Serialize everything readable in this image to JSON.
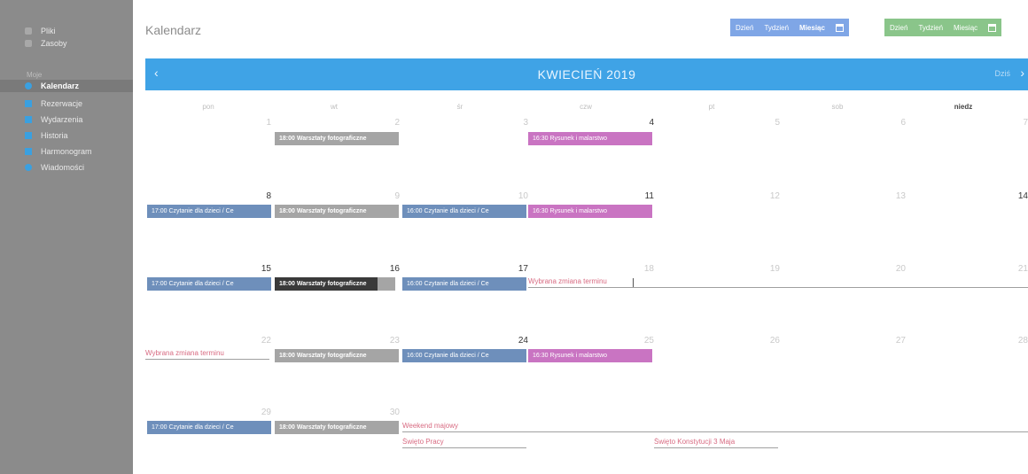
{
  "sidebar": {
    "top_items": [
      {
        "label": "Pliki",
        "icon": "file-icon"
      },
      {
        "label": "Zasoby",
        "icon": "resources-icon"
      }
    ],
    "section_label": "Moje",
    "items": [
      {
        "label": "Kalendarz",
        "icon": "calendar-icon"
      },
      {
        "label": "Rezerwacje",
        "icon": "bookmark-icon"
      },
      {
        "label": "Wydarzenia",
        "icon": "event-icon"
      },
      {
        "label": "Historia",
        "icon": "history-icon"
      },
      {
        "label": "Harmonogram",
        "icon": "schedule-icon"
      },
      {
        "label": "Wiadomości",
        "icon": "message-icon"
      }
    ]
  },
  "header": {
    "title": "Kalendarz",
    "view_buttons": [
      "Dzień",
      "Tydzień",
      "Miesiąc"
    ],
    "view_buttons_2": [
      "Dzień",
      "Tydzień",
      "Miesiąc"
    ]
  },
  "calendar": {
    "month_title": "KWIECIEŃ 2019",
    "prev_label": "‹",
    "next_label": "›",
    "today_label": "Dziś",
    "weekdays": [
      "pon",
      "wt",
      "śr",
      "czw",
      "pt",
      "sob",
      "niedz"
    ],
    "weeks": [
      {
        "days": [
          "1",
          "2",
          "3",
          "4",
          "5",
          "6",
          "7"
        ]
      },
      {
        "days": [
          "8",
          "9",
          "10",
          "11",
          "12",
          "13",
          "14"
        ]
      },
      {
        "days": [
          "15",
          "16",
          "17",
          "18",
          "19",
          "20",
          "21"
        ]
      },
      {
        "days": [
          "22",
          "23",
          "24",
          "25",
          "26",
          "27",
          "28"
        ]
      },
      {
        "days": [
          "29",
          "30",
          "",
          "",
          "",
          "",
          ""
        ]
      }
    ],
    "events": [
      {
        "text": "18:00 Warsztaty fotograficzne",
        "kind": "grey"
      },
      {
        "text": "16:30 Rysunek i malarstwo",
        "kind": "pink"
      },
      {
        "text": "17:00 Czytanie dla dzieci / Ce",
        "kind": "blue"
      },
      {
        "text": "18:00 Warsztaty fotograficzne",
        "kind": "grey"
      },
      {
        "text": "16:00 Czytanie dla dzieci / Ce",
        "kind": "blue"
      },
      {
        "text": "16:30 Rysunek i malarstwo",
        "kind": "pink"
      },
      {
        "text": "17:00 Czytanie dla dzieci / Ce",
        "kind": "blue"
      },
      {
        "text": "18:00 Warsztaty fotograficzne",
        "kind": "dark"
      },
      {
        "text": "16:00 Czytanie dla dzieci / Ce",
        "kind": "blue"
      },
      {
        "text": "Wybrana zmiana terminu",
        "kind": "text"
      },
      {
        "text": "Wybrana zmiana terminu",
        "kind": "text"
      },
      {
        "text": "18:00 Warsztaty fotograficzne",
        "kind": "grey"
      },
      {
        "text": "16:00 Czytanie dla dzieci / Ce",
        "kind": "blue"
      },
      {
        "text": "16:30 Rysunek i malarstwo",
        "kind": "pink"
      },
      {
        "text": "17:00 Czytanie dla dzieci / Ce",
        "kind": "blue"
      },
      {
        "text": "18:00 Warsztaty fotograficzne",
        "kind": "grey"
      },
      {
        "text": "Weekend majowy",
        "kind": "text"
      },
      {
        "text": "Święto Pracy",
        "kind": "text"
      },
      {
        "text": "Święto Konstytucji 3 Maja",
        "kind": "text"
      }
    ]
  },
  "colors": {
    "sidebar": "#8b8b8b",
    "monthbar": "#3fa3e6",
    "event_blue": "#6e8fbb",
    "event_grey": "#a5a5a5",
    "event_pink": "#c974c2",
    "text_event": "#d86b82",
    "btn_blue": "#7fa6e6",
    "btn_green": "#8ac58a"
  }
}
